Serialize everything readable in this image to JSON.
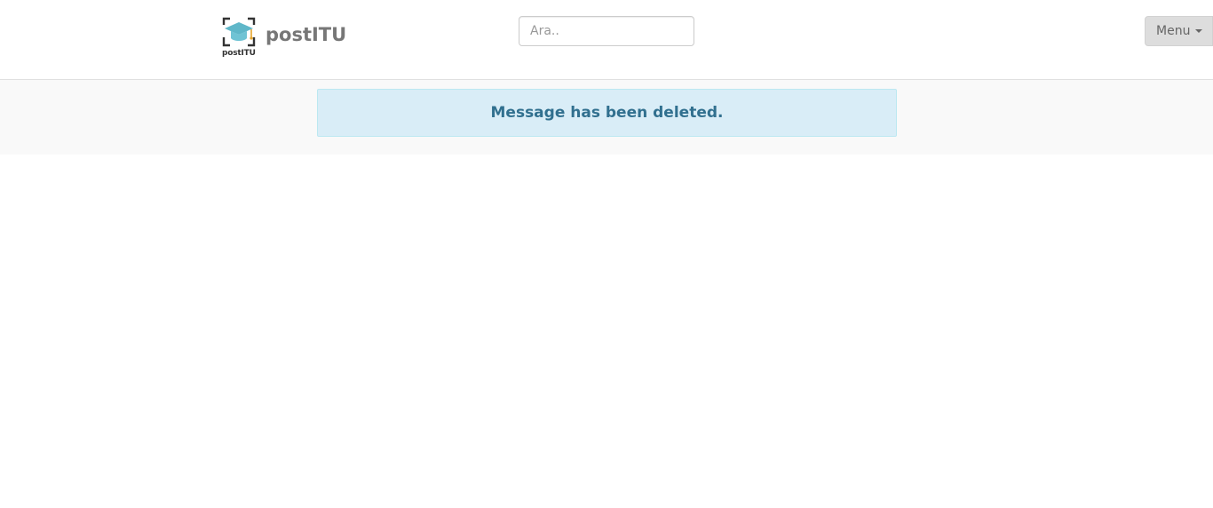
{
  "header": {
    "logo_caption": "postITU",
    "brand_name": "postITU",
    "logo_icon": "graduation-cap-icon",
    "logo_accent_color": "#5fb7c9",
    "logo_bracket_color": "#333333"
  },
  "search": {
    "placeholder": "Ara..",
    "value": ""
  },
  "menu": {
    "label": "Menu",
    "icon": "caret-down-icon"
  },
  "alert": {
    "message": "Message has been deleted.",
    "background_color": "#d9edf7",
    "text_color": "#31708f"
  }
}
